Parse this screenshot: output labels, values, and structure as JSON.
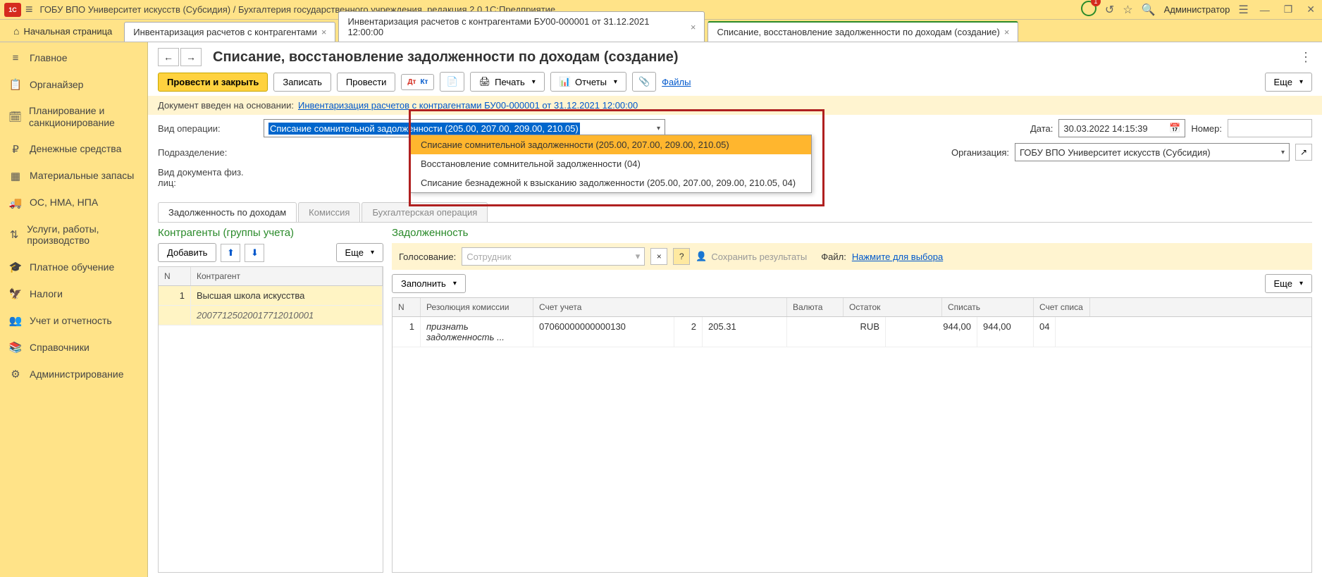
{
  "app_title": "ГОБУ ВПО Университет искусств (Субсидия) / Бухгалтерия государственного учреждения, редакция 2.0 1С:Предприятие",
  "user": "Администратор",
  "bell_count": "1",
  "tabs": {
    "home": "Начальная страница",
    "t1": "Инвентаризация расчетов с контрагентами",
    "t2": "Инвентаризация расчетов с контрагентами БУ00-000001 от 31.12.2021 12:00:00",
    "t3": "Списание, восстановление задолженности по доходам (создание)"
  },
  "sidebar": [
    {
      "icon": "≡",
      "label": "Главное"
    },
    {
      "icon": "📋",
      "label": "Органайзер"
    },
    {
      "icon": "🗓",
      "label": "Планирование и санкционирование"
    },
    {
      "icon": "₽",
      "label": "Денежные средства"
    },
    {
      "icon": "▦",
      "label": "Материальные запасы"
    },
    {
      "icon": "🚚",
      "label": "ОС, НМА, НПА"
    },
    {
      "icon": "⇅",
      "label": "Услуги, работы, производство"
    },
    {
      "icon": "🎓",
      "label": "Платное обучение"
    },
    {
      "icon": "🦅",
      "label": "Налоги"
    },
    {
      "icon": "👥",
      "label": "Учет и отчетность"
    },
    {
      "icon": "📚",
      "label": "Справочники"
    },
    {
      "icon": "⚙",
      "label": "Администрирование"
    }
  ],
  "page_title": "Списание, восстановление задолженности по доходам (создание)",
  "toolbar": {
    "post_close": "Провести и закрыть",
    "save": "Записать",
    "post": "Провести",
    "print": "Печать",
    "reports": "Отчеты",
    "files": "Файлы",
    "more": "Еще"
  },
  "basis": {
    "label": "Документ введен на основании:",
    "link": "Инвентаризация расчетов с контрагентами БУ00-000001 от 31.12.2021 12:00:00"
  },
  "form": {
    "op_label": "Вид операции:",
    "op_value": "Списание сомнительной задолженности (205.00, 207.00, 209.00, 210.05)",
    "op_options": [
      "Списание сомнительной задолженности (205.00, 207.00, 209.00, 210.05)",
      "Восстановление сомнительной задолженности (04)",
      "Списание безнадежной к взысканию задолженности (205.00, 207.00, 209.00, 210.05, 04)"
    ],
    "date_label": "Дата:",
    "date_value": "30.03.2022 14:15:39",
    "num_label": "Номер:",
    "division_label": "Подразделение:",
    "org_label": "Организация:",
    "org_value": "ГОБУ ВПО Университет искусств (Субсидия)",
    "doctype_label": "Вид документа физ. лиц:"
  },
  "doc_tabs": {
    "t1": "Задолженность по доходам",
    "t2": "Комиссия",
    "t3": "Бухгалтерская операция"
  },
  "left_panel": {
    "title": "Контрагенты (группы учета)",
    "add": "Добавить",
    "more": "Еще",
    "head_n": "N",
    "head_contr": "Контрагент",
    "row_n": "1",
    "row_contr": "Высшая школа искусства",
    "row_code": "20077125020017712010001"
  },
  "right_panel": {
    "title": "Задолженность",
    "voting_label": "Голосование:",
    "voting_placeholder": "Сотрудник",
    "save_results": "Сохранить результаты",
    "file_label": "Файл:",
    "file_link": "Нажмите для выбора",
    "fill": "Заполнить",
    "more": "Еще",
    "head": {
      "n": "N",
      "res": "Резолюция комиссии",
      "acc": "Счет учета",
      "cur": "Валюта",
      "rest": "Остаток",
      "writeoff": "Списать",
      "acc2": "Счет списа"
    },
    "row": {
      "n": "1",
      "res": "признать задолженность ...",
      "acc": "07060000000000130",
      "accsub": "2",
      "acc205": "205.31",
      "cur": "RUB",
      "rest": "944,00",
      "writeoff": "944,00",
      "acc2": "04"
    }
  }
}
